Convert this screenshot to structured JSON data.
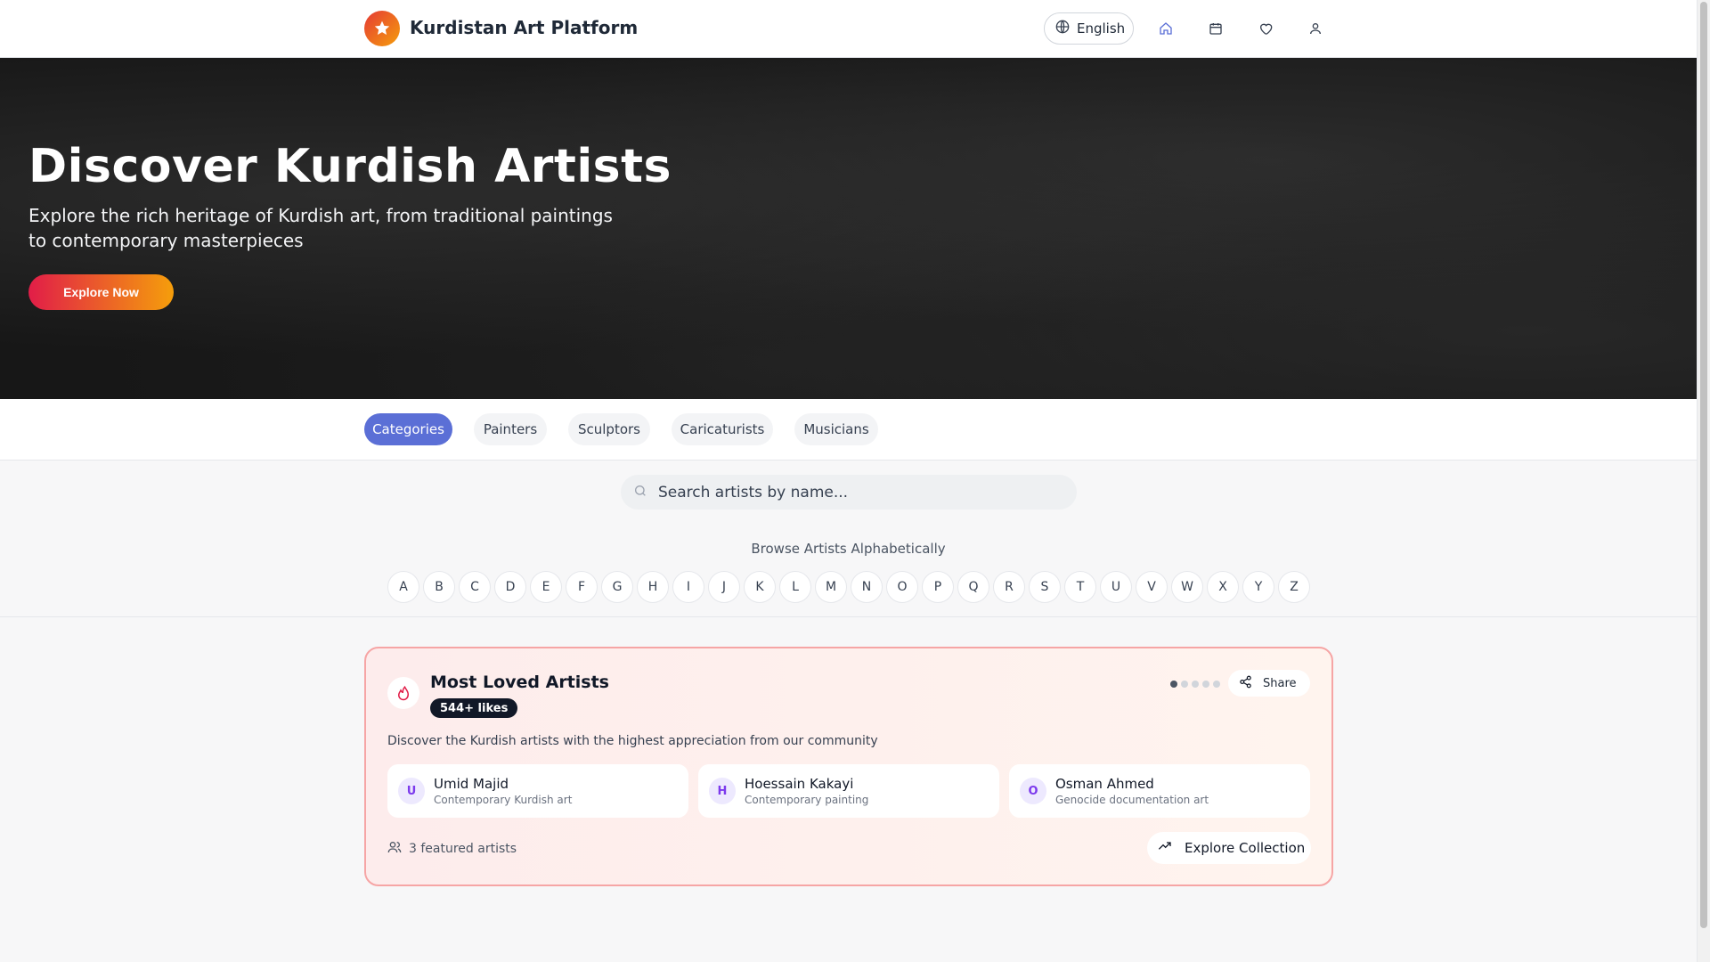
{
  "header": {
    "brand": "Kurdistan Art Platform",
    "language": "English",
    "nav_icons": [
      "home-icon",
      "calendar-icon",
      "heart-icon",
      "user-icon"
    ]
  },
  "hero": {
    "title": "Discover Kurdish Artists",
    "subtitle": "Explore the rich heritage of Kurdish art, from traditional paintings to contemporary masterpieces",
    "cta": "Explore Now"
  },
  "categories": {
    "active": "Categories",
    "items": [
      "Categories",
      "Painters",
      "Sculptors",
      "Caricaturists",
      "Musicians"
    ]
  },
  "search": {
    "placeholder": "Search artists by name..."
  },
  "alphabet": {
    "label": "Browse Artists Alphabetically",
    "letters": [
      "A",
      "B",
      "C",
      "D",
      "E",
      "F",
      "G",
      "H",
      "I",
      "J",
      "K",
      "L",
      "M",
      "N",
      "O",
      "P",
      "Q",
      "R",
      "S",
      "T",
      "U",
      "V",
      "W",
      "X",
      "Y",
      "Z"
    ]
  },
  "collection": {
    "title": "Most Loved Artists",
    "badge": "544+ likes",
    "share": "Share",
    "description": "Discover the Kurdish artists with the highest appreciation from our community",
    "carousel_pages": 5,
    "carousel_active": 1,
    "artists": [
      {
        "initial": "U",
        "name": "Umid Majid",
        "desc": "Contemporary Kurdish art"
      },
      {
        "initial": "H",
        "name": "Hoessain Kakayi",
        "desc": "Contemporary painting"
      },
      {
        "initial": "O",
        "name": "Osman Ahmed",
        "desc": "Genocide documentation art"
      }
    ],
    "featured": "3 featured artists",
    "explore": "Explore Collection"
  },
  "colors": {
    "accent": "#5b6fd6",
    "cta_start": "#e11d48",
    "cta_end": "#f59e0b",
    "card_border": "#f6a5a5"
  }
}
